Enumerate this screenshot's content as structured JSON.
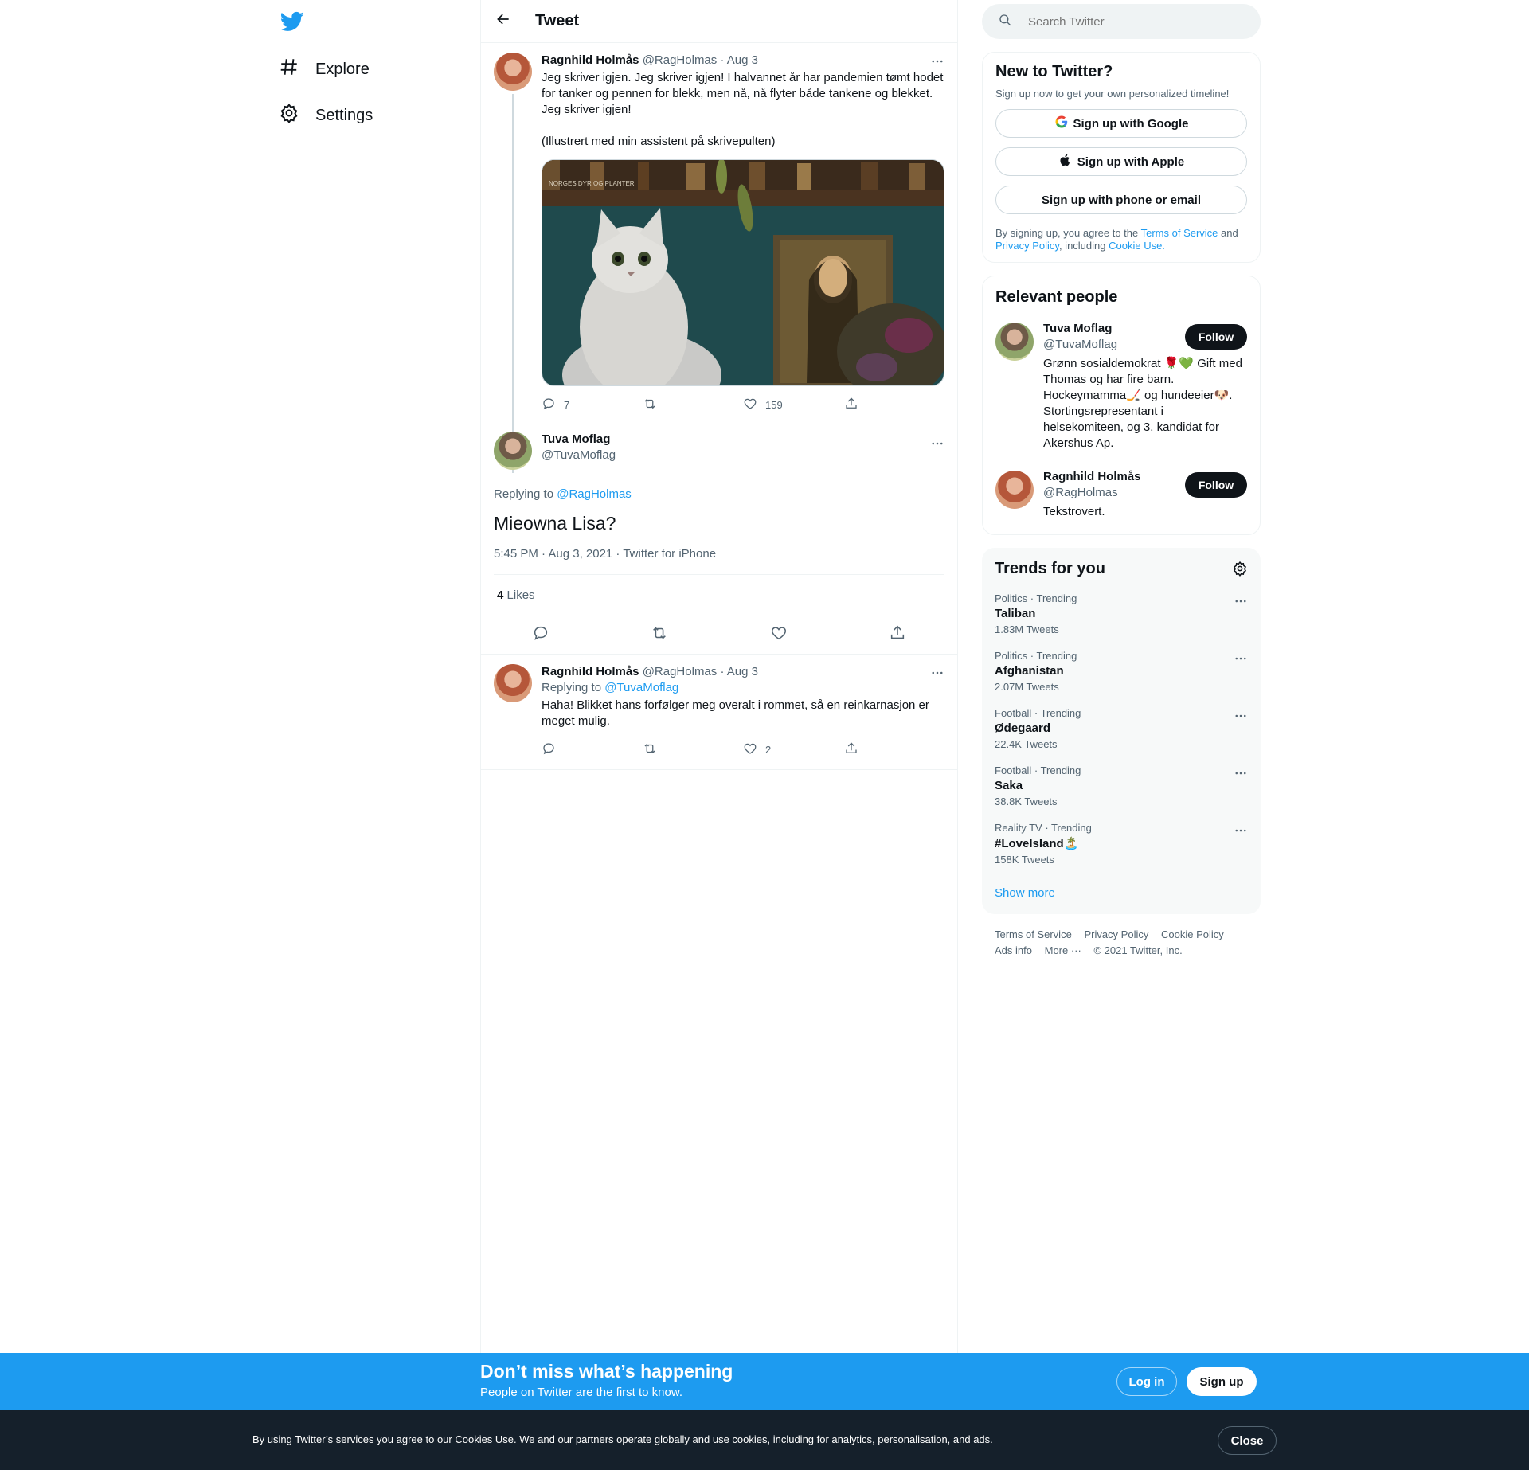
{
  "nav": {
    "items": [
      {
        "label": "Explore",
        "icon": "hashtag-icon"
      },
      {
        "label": "Settings",
        "icon": "gear-icon"
      }
    ]
  },
  "header": {
    "title": "Tweet"
  },
  "thread": {
    "parent": {
      "name": "Ragnhild Holmås",
      "handle": "@RagHolmas",
      "date": "· Aug 3",
      "text": "Jeg skriver igjen. Jeg skriver igjen! I halvannet år har pandemien tømt hodet for tanker og pennen for blekk, men nå, nå flyter både tankene og blekket. Jeg skriver igjen!\n\n(Illustrert med min assistent på skrivepulten)",
      "media_label": "NORGES DYR OG PLANTER",
      "replies": "7",
      "retweets": "",
      "likes": "159"
    },
    "main": {
      "name": "Tuva Moflag",
      "handle": "@TuvaMoflag",
      "replying_prefix": "Replying to ",
      "replying_to": "@RagHolmas",
      "text": "Mieowna Lisa?",
      "timestamp": "5:45 PM · Aug 3, 2021 · Twitter for iPhone",
      "likes_count": "4",
      "likes_label": "Likes"
    },
    "reply": {
      "name": "Ragnhild Holmås",
      "handle": "@RagHolmas",
      "date": "· Aug 3",
      "replying_prefix": "Replying to ",
      "replying_to": "@TuvaMoflag",
      "text": "Haha! Blikket hans forfølger meg overalt i rommet, så en reinkarnasjon er meget mulig.",
      "replies": "",
      "retweets": "",
      "likes": "2"
    }
  },
  "search": {
    "placeholder": "Search Twitter"
  },
  "signup": {
    "title": "New to Twitter?",
    "subtitle": "Sign up now to get your own personalized timeline!",
    "google": "Sign up with Google",
    "apple": "Sign up with Apple",
    "phone": "Sign up with phone or email",
    "legal_1": "By signing up, you agree to the ",
    "terms": "Terms of Service",
    "legal_2": " and ",
    "privacy": "Privacy Policy",
    "legal_3": ", including ",
    "cookie": "Cookie Use."
  },
  "relevant": {
    "title": "Relevant people",
    "people": [
      {
        "name": "Tuva Moflag",
        "handle": "@TuvaMoflag",
        "bio": "Grønn sosialdemokrat 🌹💚 Gift med Thomas og har fire barn. Hockeymamma🏒 og hundeeier🐶. Stortingsrepresentant i helsekomiteen, og 3. kandidat for Akershus Ap.",
        "follow": "Follow"
      },
      {
        "name": "Ragnhild Holmås",
        "handle": "@RagHolmas",
        "bio": "Tekstrovert.",
        "follow": "Follow"
      }
    ]
  },
  "trends": {
    "title": "Trends for you",
    "items": [
      {
        "category": "Politics · Trending",
        "name": "Taliban",
        "count": "1.83M Tweets"
      },
      {
        "category": "Politics · Trending",
        "name": "Afghanistan",
        "count": "2.07M Tweets"
      },
      {
        "category": "Football · Trending",
        "name": "Ødegaard",
        "count": "22.4K Tweets"
      },
      {
        "category": "Football · Trending",
        "name": "Saka",
        "count": "38.8K Tweets"
      },
      {
        "category": "Reality TV · Trending",
        "name": "#LoveIsland🏝️",
        "count": "158K Tweets"
      }
    ],
    "show_more": "Show more"
  },
  "footer": {
    "links": [
      "Terms of Service",
      "Privacy Policy",
      "Cookie Policy",
      "Ads info",
      "More ···",
      "© 2021 Twitter, Inc."
    ]
  },
  "banner": {
    "title": "Don’t miss what’s happening",
    "subtitle": "People on Twitter are the first to know.",
    "login": "Log in",
    "signup": "Sign up"
  },
  "cookie_bar": {
    "text": "By using Twitter’s services you agree to our Cookies Use. We and our partners operate globally and use cookies, including for analytics, personalisation, and ads.",
    "close": "Close"
  },
  "colors": {
    "accent": "#1d9bf0",
    "text": "#0f1419",
    "muted": "#536471",
    "border": "#eff3f4",
    "cookie_bg": "#15202b"
  }
}
